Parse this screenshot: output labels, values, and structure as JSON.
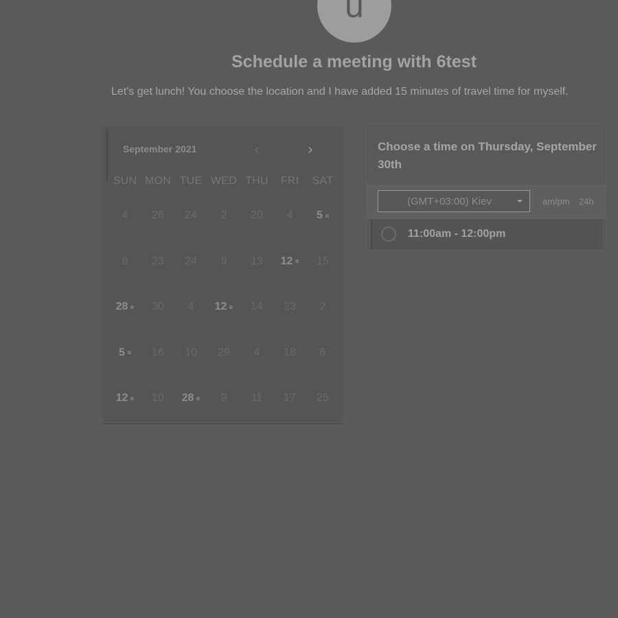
{
  "host": {
    "avatar_initial": "u"
  },
  "header": {
    "title": "Schedule a meeting with 6test",
    "description": "Let's get lunch! You choose the location and I have added 15 minutes of travel time for myself."
  },
  "calendar": {
    "month_label": "September 2021",
    "prev_icon": "‹",
    "next_icon": "›",
    "weekdays": [
      "SUN",
      "MON",
      "TUE",
      "WED",
      "THU",
      "FRI",
      "SAT"
    ],
    "weeks": [
      [
        "4",
        "26",
        "24",
        "2",
        "20",
        "4",
        "5"
      ],
      [
        "8",
        "23",
        "24",
        "9",
        "13",
        "12",
        "15"
      ],
      [
        "28",
        "30",
        "4",
        "12",
        "14",
        "23",
        "2"
      ],
      [
        "5",
        "16",
        "10",
        "29",
        "4",
        "18",
        "8"
      ],
      [
        "12",
        "10",
        "28",
        "9",
        "11",
        "17",
        "25"
      ]
    ],
    "available": [
      [
        false,
        false,
        false,
        false,
        false,
        false,
        true
      ],
      [
        false,
        false,
        false,
        false,
        false,
        true,
        false
      ],
      [
        true,
        false,
        false,
        true,
        false,
        false,
        false
      ],
      [
        true,
        false,
        false,
        false,
        false,
        false,
        false
      ],
      [
        true,
        false,
        true,
        false,
        false,
        false,
        false
      ]
    ]
  },
  "time_picker": {
    "heading": "Choose a time on Thursday, September 30th",
    "timezone": "(GMT+03:00) Kiev",
    "format_ampm": "am/pm",
    "format_24h": "24h",
    "slots": [
      "11:00am - 12:00pm"
    ]
  }
}
